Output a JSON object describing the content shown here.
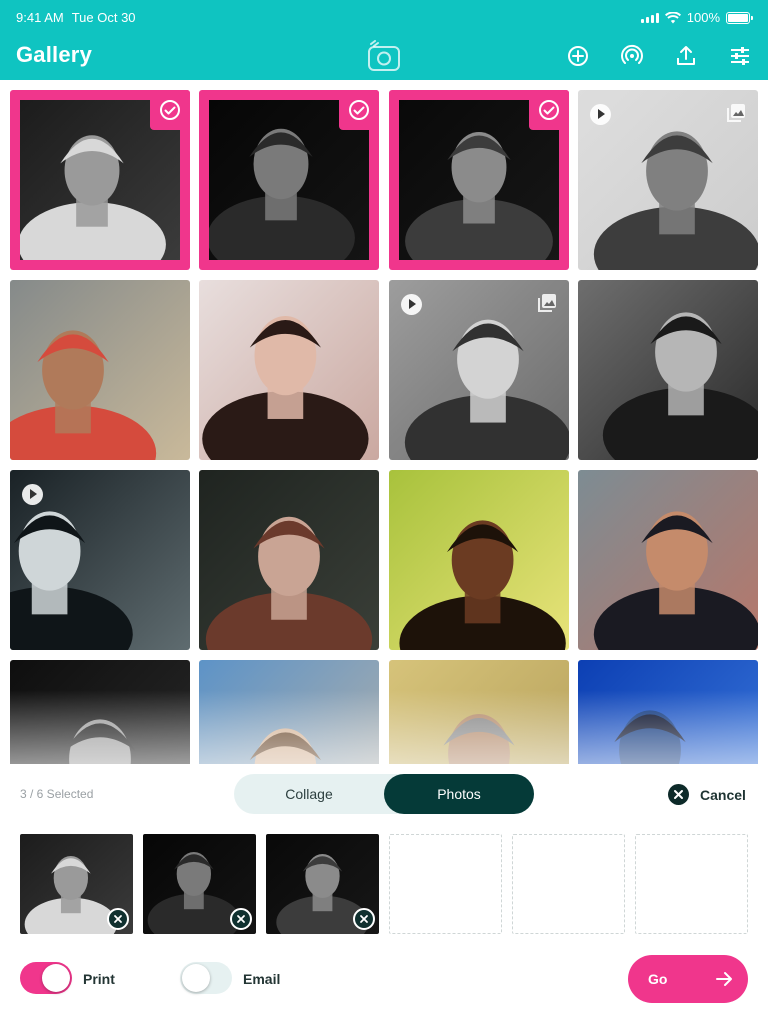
{
  "status_bar": {
    "time": "9:41 AM",
    "date": "Tue Oct 30",
    "battery": "100%"
  },
  "header": {
    "title": "Gallery",
    "center_icon": "camera-icon",
    "actions": [
      "add-circle-icon",
      "broadcast-icon",
      "share-icon",
      "sliders-icon"
    ]
  },
  "grid": {
    "items": [
      {
        "subject": "man-wavy-hair",
        "selected": true,
        "video": false
      },
      {
        "subject": "man-smoking",
        "selected": true,
        "video": false
      },
      {
        "subject": "man-sunglasses-profile",
        "selected": true,
        "video": false
      },
      {
        "subject": "woman-city",
        "selected": false,
        "video": true,
        "faded": true
      },
      {
        "subject": "elder-and-boy",
        "selected": false,
        "video": false
      },
      {
        "subject": "woman-dark-hair",
        "selected": false,
        "video": false
      },
      {
        "subject": "woman-sunglasses-bw",
        "selected": false,
        "video": true,
        "faded": true
      },
      {
        "subject": "woman-arch-bw",
        "selected": false,
        "video": false
      },
      {
        "subject": "woman-profile-bokeh",
        "selected": false,
        "video": true
      },
      {
        "subject": "woman-forest",
        "selected": false,
        "video": false
      },
      {
        "subject": "woman-braids",
        "selected": false,
        "video": false
      },
      {
        "subject": "woman-sunglasses-flannel",
        "selected": false,
        "video": false
      },
      {
        "subject": "man-closeup",
        "selected": false,
        "video": false
      },
      {
        "subject": "woman-rocks",
        "selected": false,
        "video": false
      },
      {
        "subject": "old-man-face",
        "selected": false,
        "video": false
      },
      {
        "subject": "man-blue-light",
        "selected": false,
        "video": false
      }
    ]
  },
  "selection": {
    "count_text": "3 / 6 Selected",
    "tabs": [
      {
        "label": "Collage",
        "active": false
      },
      {
        "label": "Photos",
        "active": true
      }
    ],
    "cancel_label": "Cancel",
    "slots": [
      "man-wavy-hair",
      "man-smoking",
      "man-sunglasses-profile",
      null,
      null,
      null
    ]
  },
  "options": [
    {
      "label": "Print",
      "on": true
    },
    {
      "label": "Email",
      "on": false
    }
  ],
  "go_label": "Go",
  "colors": {
    "header": "#0fc4c1",
    "accent": "#f0368c",
    "dark": "#053a38",
    "segment_bg": "#e6f1f1"
  }
}
